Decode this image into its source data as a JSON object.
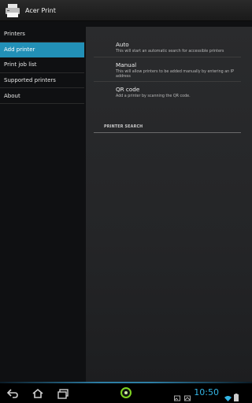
{
  "app": {
    "title": "Acer Print"
  },
  "sidebar": {
    "items": [
      {
        "label": "Printers"
      },
      {
        "label": "Add printer"
      },
      {
        "label": "Print job list"
      },
      {
        "label": "Supported printers"
      },
      {
        "label": "About"
      }
    ]
  },
  "options": [
    {
      "title": "Auto",
      "desc": "This will start an automatic search for accessible printers"
    },
    {
      "title": "Manual",
      "desc": "This will allow printers to be added manually by entering an IP address"
    },
    {
      "title": "QR code",
      "desc": "Add a printer by scanning the QR code."
    }
  ],
  "section": {
    "label": "PRINTER SEARCH"
  },
  "statusbar": {
    "time": "10:50"
  },
  "colors": {
    "accent": "#2290b7",
    "time": "#33b5e5",
    "home_ring": "#7ed321"
  },
  "icons": {
    "app": "printer-icon",
    "nav": [
      "back-icon",
      "home-icon",
      "recent-apps-icon"
    ],
    "status": [
      "gallery-icon",
      "image-icon",
      "wifi-icon",
      "battery-icon"
    ]
  }
}
